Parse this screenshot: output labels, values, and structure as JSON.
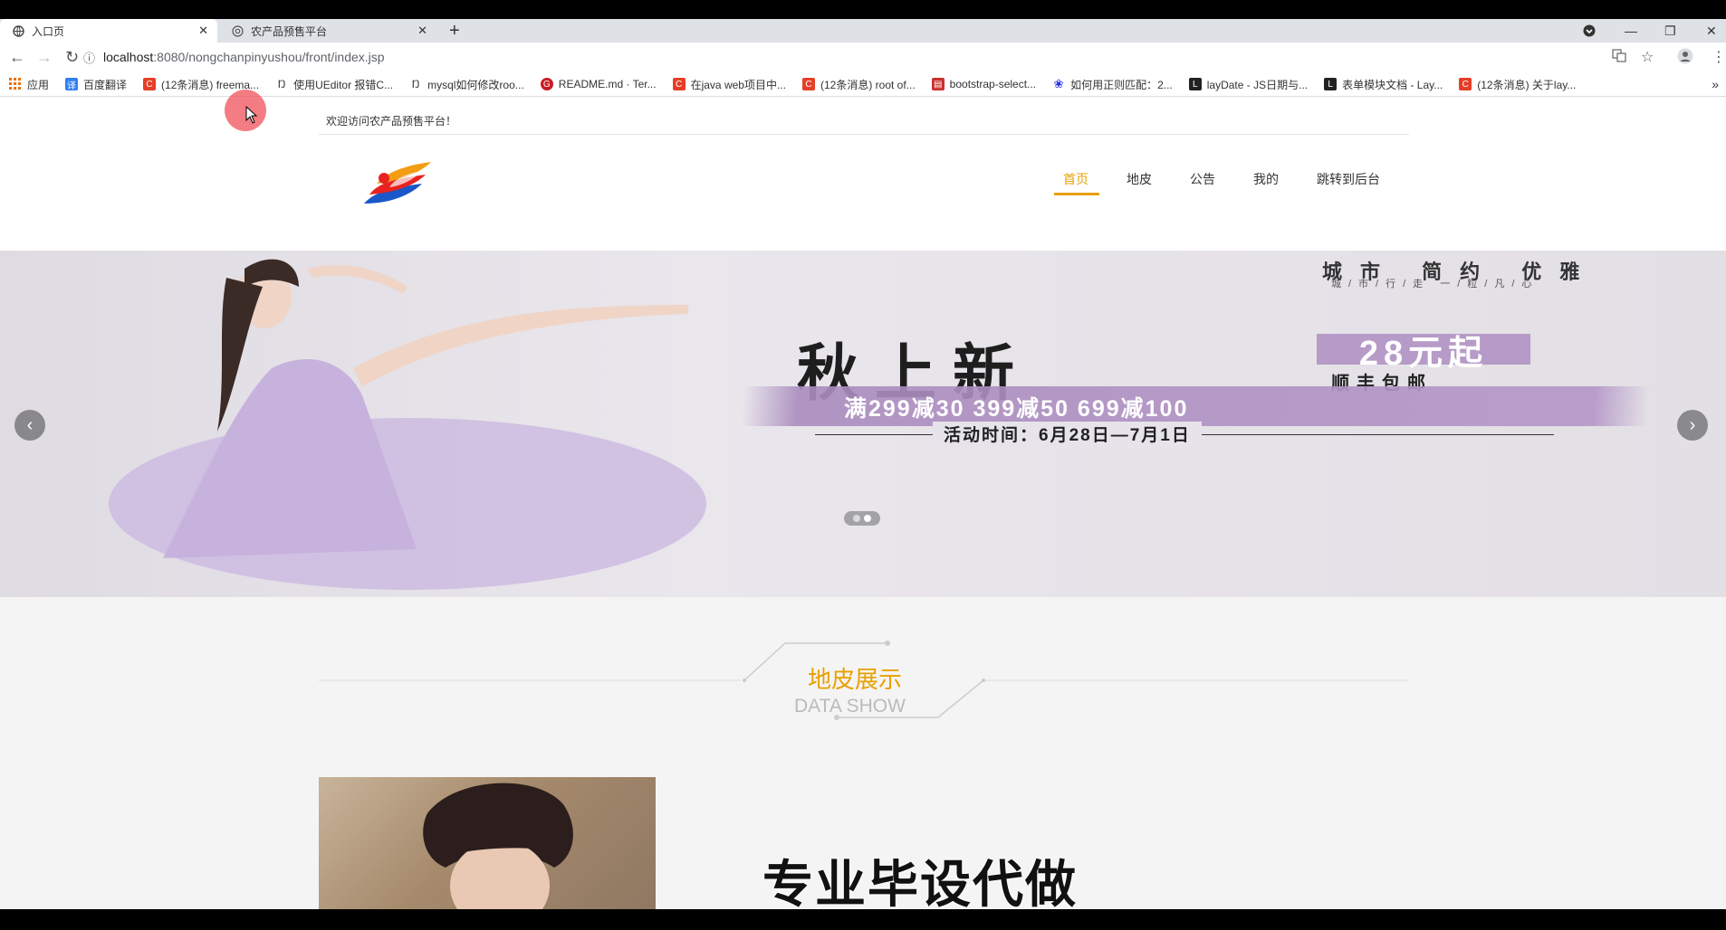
{
  "browser": {
    "tabs": [
      {
        "label": "入口页",
        "active": true
      },
      {
        "label": "农产品预售平台",
        "active": false
      }
    ],
    "url_host": "localhost",
    "url_path": ":8080/nongchanpinyushou/front/index.jsp",
    "bookmarks": [
      {
        "label": "应用",
        "icon": "apps-icon",
        "color": "#e8710a"
      },
      {
        "label": "百度翻译",
        "icon": "translate-icon",
        "color": "#2f7ff5"
      },
      {
        "label": "(12条消息) freema...",
        "icon": "csdn-icon",
        "color": "#e63e27"
      },
      {
        "label": "使用UEditor 报错C...",
        "icon": "ueditor-icon",
        "color": "#333333"
      },
      {
        "label": "mysql如何修改roo...",
        "icon": "ueditor-icon",
        "color": "#333333"
      },
      {
        "label": "README.md · Ter...",
        "icon": "gitee-icon",
        "color": "#c71d23"
      },
      {
        "label": "在java web项目中...",
        "icon": "csdn-icon",
        "color": "#e63e27"
      },
      {
        "label": "(12条消息) root of...",
        "icon": "csdn-icon",
        "color": "#e63e27"
      },
      {
        "label": "bootstrap-select...",
        "icon": "cnblogs-icon",
        "color": "#c9302c"
      },
      {
        "label": "如何用正则匹配：2...",
        "icon": "baidu-icon",
        "color": "#2932e1"
      },
      {
        "label": "layDate - JS日期与...",
        "icon": "layui-icon",
        "color": "#222222"
      },
      {
        "label": "表单模块文档 - Lay...",
        "icon": "layui-icon",
        "color": "#222222"
      },
      {
        "label": "(12条消息) 关于lay...",
        "icon": "csdn-icon",
        "color": "#e63e27"
      }
    ],
    "more_bookmarks": "»"
  },
  "site": {
    "welcome": "欢迎访问农产品预售平台！",
    "nav": [
      {
        "label": "首页",
        "active": true
      },
      {
        "label": "地皮",
        "active": false
      },
      {
        "label": "公告",
        "active": false
      },
      {
        "label": "我的",
        "active": false
      },
      {
        "label": "跳转到后台",
        "active": false
      }
    ],
    "accent_color": "#e8a000"
  },
  "banner": {
    "top_text": "城市 简约 优雅",
    "top_sub": "城/市/行/走  一/粒/凡/心",
    "title": "秋上新",
    "price": "28元起",
    "shipping": "顺丰包邮",
    "promo": "满299减30  399减50  699减100",
    "dates": "活动时间：6月28日—7月1日",
    "slide_count": 2,
    "active_slide": 2
  },
  "section": {
    "title": "地皮展示",
    "subtitle": "DATA SHOW"
  },
  "overlay": {
    "watermark": "专业毕设代做"
  }
}
